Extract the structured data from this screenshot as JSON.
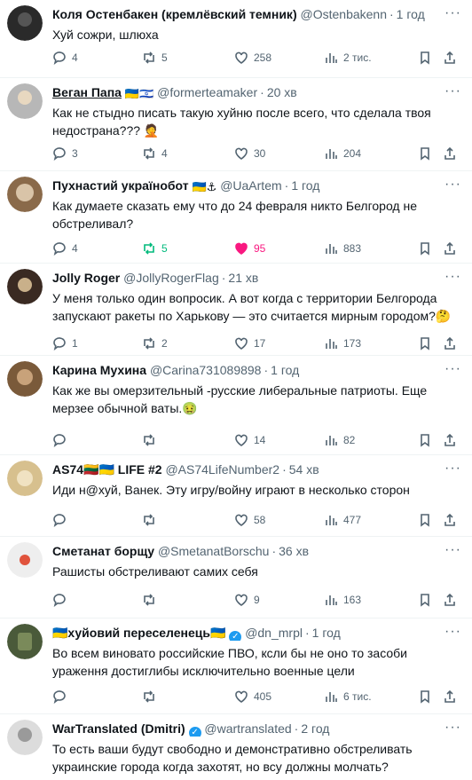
{
  "tweets": [
    {
      "name": "Коля Остенбакен (кремлёвский темник)",
      "flags": "",
      "handle": "@Ostenbakenn",
      "time": "1 год",
      "text": "Хуй сожри, шлюха",
      "emoji": "",
      "reply": "4",
      "retweet": "5",
      "like": "258",
      "views": "2 тис.",
      "retweet_active": false,
      "like_active": false,
      "avatar_color": "#222"
    },
    {
      "name": "Веган Папа",
      "flags": "🇺🇦🇮🇱",
      "handle": "@formerteamaker",
      "time": "20 хв",
      "text": "Как не стыдно писать такую хуйню после всего, что сделала твоя недострана???",
      "emoji": "🤦",
      "reply": "3",
      "retweet": "4",
      "like": "30",
      "views": "204",
      "retweet_active": false,
      "like_active": false,
      "avatar_color": "#a8a8a8"
    },
    {
      "name": "Пухнастий українобот",
      "flags": "🇺🇦⚓",
      "handle": "@UaArtem",
      "time": "1 год",
      "text": "Как думаете сказать ему что до 24 февраля никто Белгород не обстреливал?",
      "emoji": "",
      "reply": "4",
      "retweet": "5",
      "like": "95",
      "views": "883",
      "retweet_active": true,
      "like_active": true,
      "avatar_color": "#8a6a4a"
    },
    {
      "name": "Jolly Roger",
      "flags": "",
      "handle": "@JollyRogerFlag",
      "time": "21 хв",
      "text": "У меня только один вопросик. А вот когда с территории Белгорода запускают ракеты по Харькову — это считается мирным городом?",
      "emoji": "🤔",
      "reply": "1",
      "retweet": "2",
      "like": "17",
      "views": "173",
      "retweet_active": false,
      "like_active": false,
      "avatar_color": "#3a2a22"
    },
    {
      "name": "Карина Мухина",
      "flags": "",
      "handle": "@Carina731089898",
      "time": "1 год",
      "text": "Как же вы омерзительный -русские либеральные патриоты. Еще мерзее обычной ваты.",
      "emoji": "🤢",
      "reply": "",
      "retweet": "",
      "like": "14",
      "views": "82",
      "retweet_active": false,
      "like_active": false,
      "avatar_color": "#7a5a3a"
    },
    {
      "name": "AS74🇱🇹🇺🇦 LIFE #2",
      "flags": "",
      "handle": "@AS74LifeNumber2",
      "time": "54 хв",
      "text": "Иди н@хуй, Ванек. Эту игру/войну играют в несколько сторон",
      "emoji": "",
      "reply": "",
      "retweet": "",
      "like": "58",
      "views": "477",
      "retweet_active": false,
      "like_active": false,
      "avatar_color": "#c9a76e"
    },
    {
      "name": "Сметанат борщу",
      "flags": "",
      "handle": "@SmetanatBorschu",
      "time": "36 хв",
      "text": "Рашисты обстреливают самих себя",
      "emoji": "",
      "reply": "",
      "retweet": "",
      "like": "9",
      "views": "163",
      "retweet_active": false,
      "like_active": false,
      "avatar_color": "#e8e8e8"
    },
    {
      "name": "🇺🇦хуйовий переселенець🇺🇦",
      "flags": "",
      "handle": "@dn_mrpl",
      "time": "1 год",
      "text": "Во всем виновато российские ПВО, кcли бы не оно то засоби ураження достиглибы исключительно военные цели",
      "emoji": "",
      "reply": "",
      "retweet": "",
      "like": "405",
      "views": "6 тис.",
      "retweet_active": false,
      "like_active": false,
      "avatar_color": "#4a5a3a",
      "verified": true
    },
    {
      "name": "WarTranslated (Dmitri)",
      "flags": "",
      "handle": "@wartranslated",
      "time": "2 год",
      "text": "То есть ваши будут свободно и демонстративно обстреливать украинские города когда захотят, но всу должны молчать?",
      "emoji": "",
      "reply": "",
      "retweet": "",
      "like": "",
      "views": "",
      "retweet_active": false,
      "like_active": false,
      "avatar_color": "#dcdcdc",
      "verified": true
    }
  ]
}
